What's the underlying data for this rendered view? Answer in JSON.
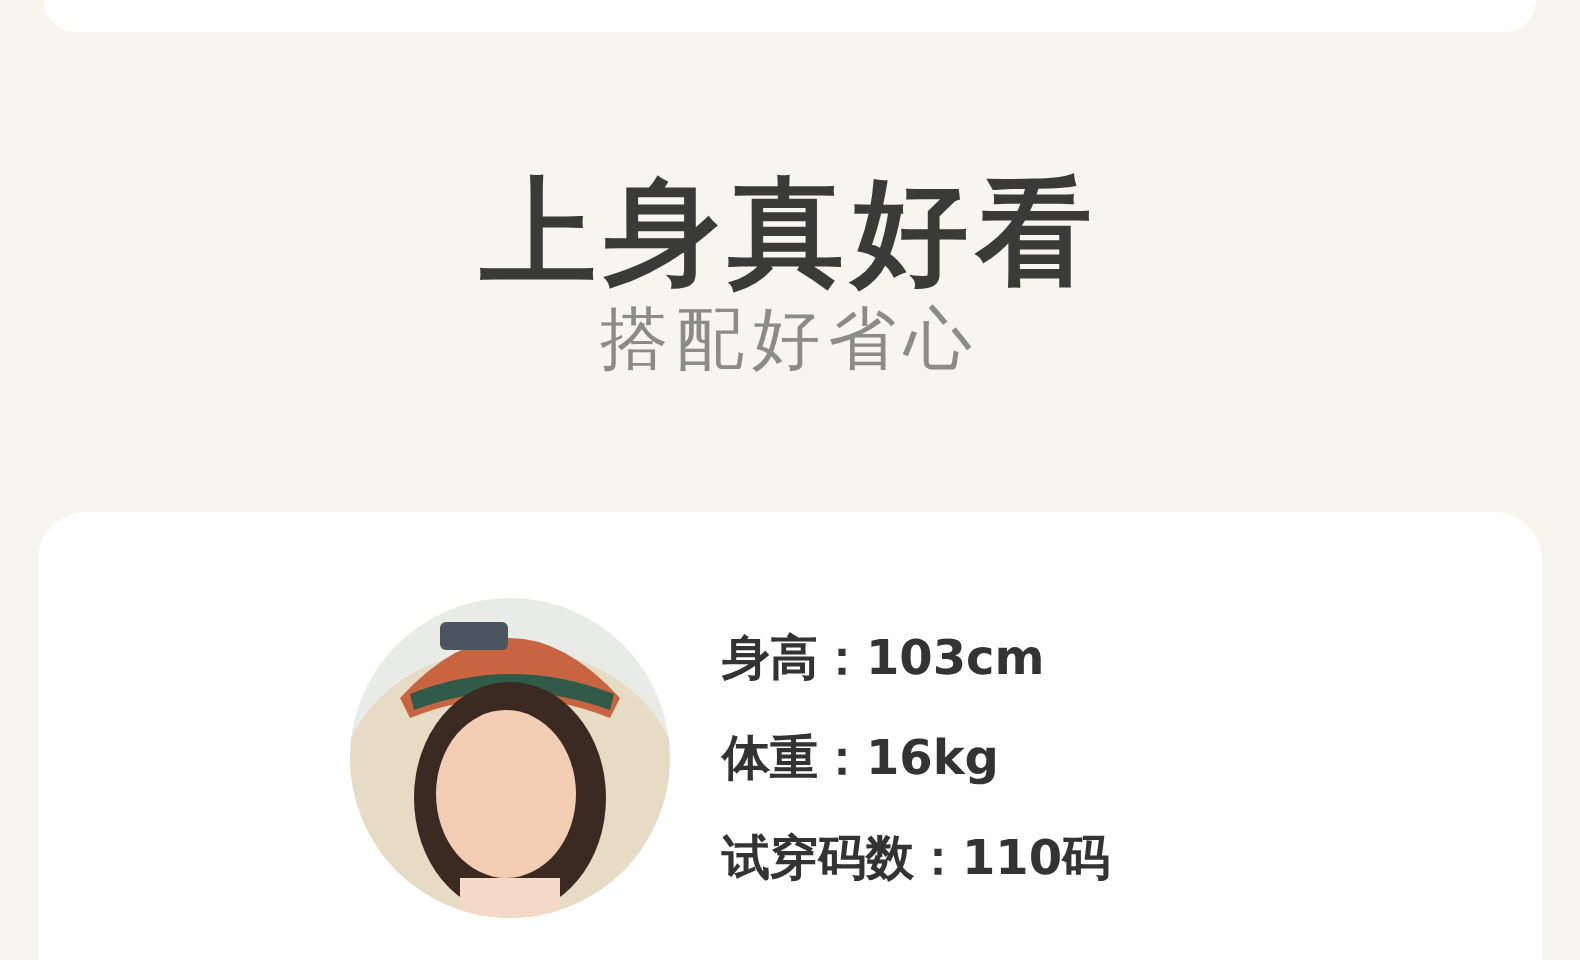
{
  "heading": {
    "title": "上身真好看",
    "subtitle": "搭配好省心"
  },
  "model": {
    "specs": [
      "身高：103cm",
      "体重：16kg",
      "试穿码数：110码"
    ]
  }
}
